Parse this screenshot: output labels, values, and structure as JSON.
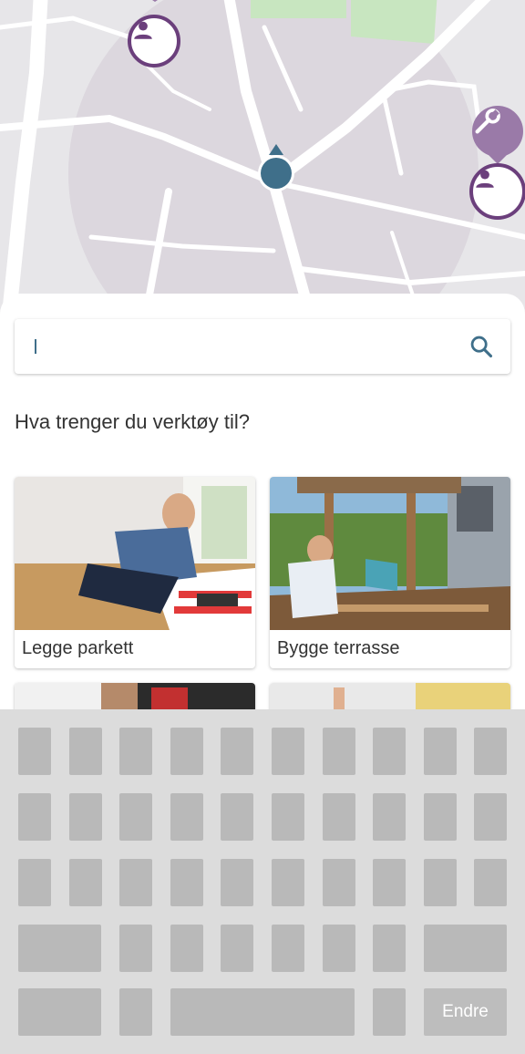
{
  "map": {
    "markers": [
      {
        "name": "user-marker-top",
        "icon": "person-icon"
      },
      {
        "name": "user-marker-right",
        "icon": "person-icon"
      },
      {
        "name": "tool-bubble",
        "icon": "wrench-icon"
      },
      {
        "name": "current-location",
        "icon": "location-dot-icon"
      }
    ],
    "colors": {
      "accent": "#6b3f7c",
      "location": "#3f6f8a",
      "radius": "#d9d3dc"
    }
  },
  "search": {
    "value": "",
    "placeholder": "",
    "button_icon": "search-icon",
    "icon_color": "#3f6f8a"
  },
  "heading": "Hva trenger du verktøy til?",
  "cards": [
    {
      "label": "Legge parkett"
    },
    {
      "label": "Bygge terrasse"
    }
  ],
  "keyboard": {
    "action_label": "Endre"
  }
}
